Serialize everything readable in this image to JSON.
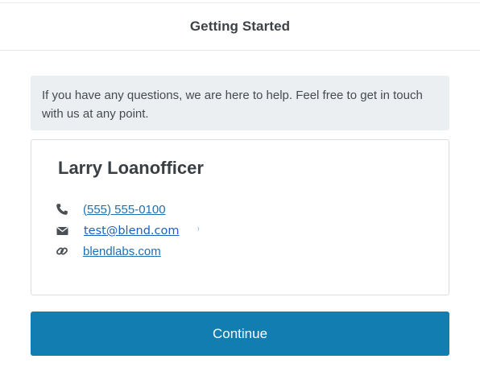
{
  "header": {
    "title": "Getting Started"
  },
  "help_banner": {
    "text": "If you have any questions, we are here to help. Feel free to get in touch with us at any point."
  },
  "contact": {
    "name": "Larry Loanofficer",
    "phone": {
      "icon": "phone-icon",
      "text": "(555) 555-0100"
    },
    "email": {
      "icon": "mail-icon",
      "text": "test@blend.com"
    },
    "website": {
      "icon": "link-icon",
      "text": "blendlabs.com"
    }
  },
  "actions": {
    "continue_label": "Continue"
  },
  "colors": {
    "accent": "#127db1",
    "link": "#1f6fb2",
    "banner_bg": "#eceff2"
  }
}
